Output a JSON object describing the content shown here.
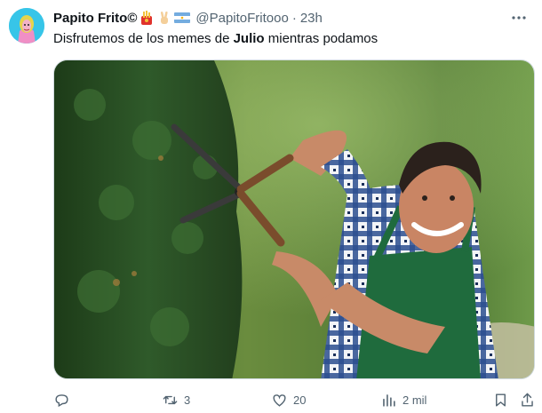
{
  "author": {
    "display_name": "Papito Frito©",
    "handle": "@PapitoFritooo",
    "separator": "·",
    "time": "23h",
    "badges": [
      "fries-emoji",
      "victory-hand-emoji",
      "argentina-flag-emoji"
    ]
  },
  "post": {
    "text_before": "Disfrutemos de los memes de ",
    "text_bold": "Julio",
    "text_after": " mientras podamos"
  },
  "actions": {
    "reply_count": "",
    "repost_count": "3",
    "like_count": "20",
    "views_count": "2 mil"
  },
  "colors": {
    "text": "#0f1419",
    "secondary": "#536471",
    "hedge": "#2f5a2a",
    "apron": "#1f6b3d",
    "shirt": "#2b4f8f"
  }
}
